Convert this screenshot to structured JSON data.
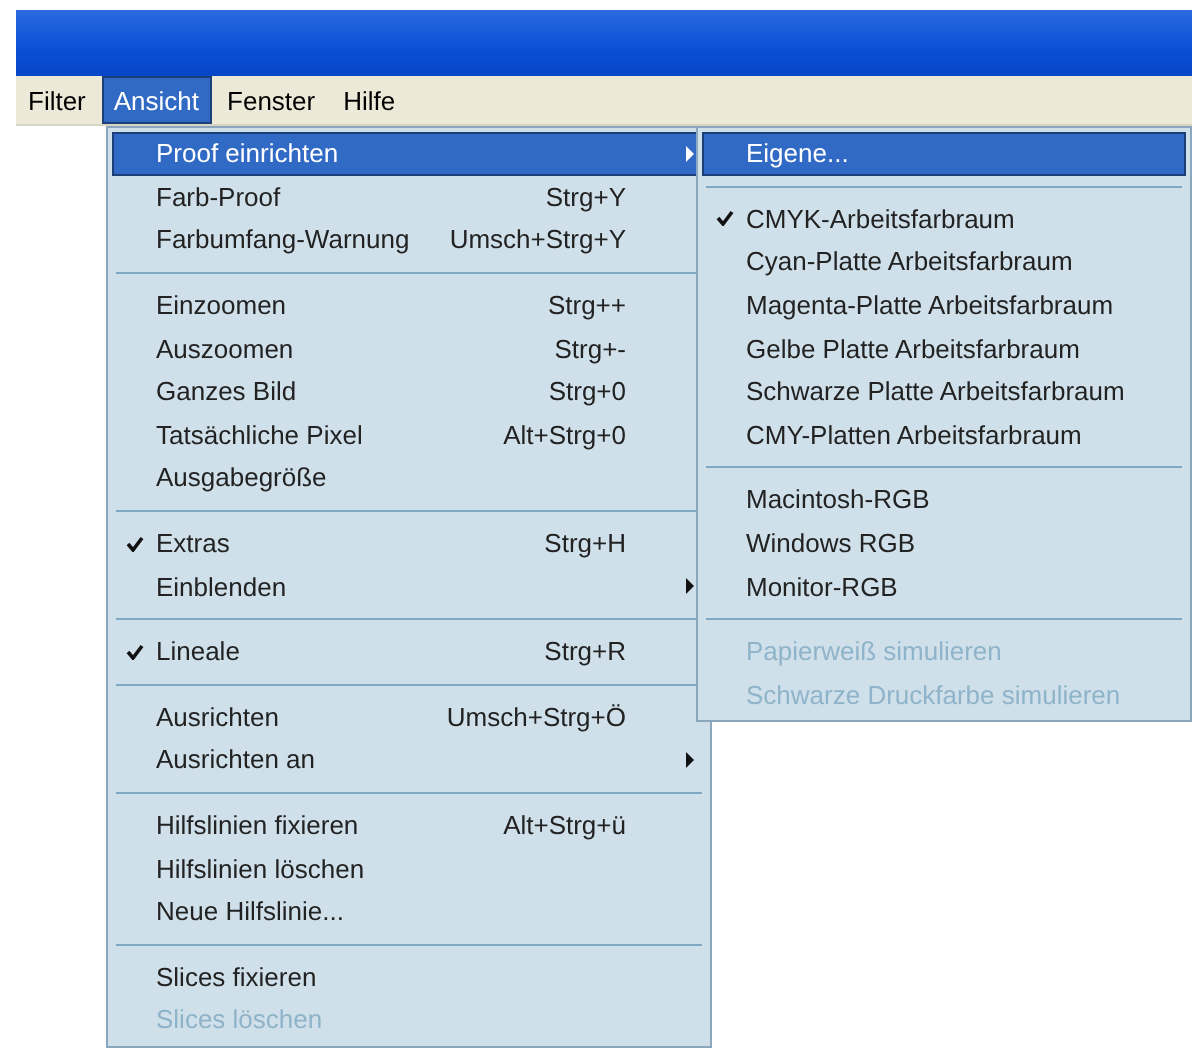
{
  "menubar": [
    {
      "label": "Filter",
      "selected": false
    },
    {
      "label": "Ansicht",
      "selected": true
    },
    {
      "label": "Fenster",
      "selected": false
    },
    {
      "label": "Hilfe",
      "selected": false
    }
  ],
  "menu": [
    {
      "kind": "item",
      "label": "Proof einrichten",
      "submenu": true,
      "selected": true,
      "checked": false,
      "disabled": false
    },
    {
      "kind": "item",
      "label": "Farb-Proof",
      "shortcut": "Strg+Y",
      "selected": false,
      "checked": false,
      "disabled": false
    },
    {
      "kind": "item",
      "label": "Farbumfang-Warnung",
      "shortcut": "Umsch+Strg+Y",
      "selected": false,
      "checked": false,
      "disabled": false
    },
    {
      "kind": "separator"
    },
    {
      "kind": "item",
      "label": "Einzoomen",
      "shortcut": "Strg++",
      "selected": false,
      "checked": false,
      "disabled": false
    },
    {
      "kind": "item",
      "label": "Auszoomen",
      "shortcut": "Strg+-",
      "selected": false,
      "checked": false,
      "disabled": false
    },
    {
      "kind": "item",
      "label": "Ganzes Bild",
      "shortcut": "Strg+0",
      "selected": false,
      "checked": false,
      "disabled": false
    },
    {
      "kind": "item",
      "label": "Tatsächliche Pixel",
      "shortcut": "Alt+Strg+0",
      "selected": false,
      "checked": false,
      "disabled": false
    },
    {
      "kind": "item",
      "label": "Ausgabegröße",
      "selected": false,
      "checked": false,
      "disabled": false
    },
    {
      "kind": "separator"
    },
    {
      "kind": "item",
      "label": "Extras",
      "shortcut": "Strg+H",
      "selected": false,
      "checked": true,
      "disabled": false
    },
    {
      "kind": "item",
      "label": "Einblenden",
      "submenu": true,
      "selected": false,
      "checked": false,
      "disabled": false
    },
    {
      "kind": "separator"
    },
    {
      "kind": "item",
      "label": "Lineale",
      "shortcut": "Strg+R",
      "selected": false,
      "checked": true,
      "disabled": false
    },
    {
      "kind": "separator"
    },
    {
      "kind": "item",
      "label": "Ausrichten",
      "shortcut": "Umsch+Strg+Ö",
      "selected": false,
      "checked": false,
      "disabled": false
    },
    {
      "kind": "item",
      "label": "Ausrichten an",
      "submenu": true,
      "selected": false,
      "checked": false,
      "disabled": false
    },
    {
      "kind": "separator"
    },
    {
      "kind": "item",
      "label": "Hilfslinien fixieren",
      "shortcut": "Alt+Strg+ü",
      "selected": false,
      "checked": false,
      "disabled": false
    },
    {
      "kind": "item",
      "label": "Hilfslinien löschen",
      "selected": false,
      "checked": false,
      "disabled": false
    },
    {
      "kind": "item",
      "label": "Neue Hilfslinie...",
      "selected": false,
      "checked": false,
      "disabled": false
    },
    {
      "kind": "separator"
    },
    {
      "kind": "item",
      "label": "Slices fixieren",
      "selected": false,
      "checked": false,
      "disabled": false
    },
    {
      "kind": "item",
      "label": "Slices löschen",
      "selected": false,
      "checked": false,
      "disabled": true
    }
  ],
  "submenu": [
    {
      "kind": "item",
      "label": "Eigene...",
      "selected": true,
      "checked": false,
      "disabled": false
    },
    {
      "kind": "separator"
    },
    {
      "kind": "item",
      "label": "CMYK-Arbeitsfarbraum",
      "selected": false,
      "checked": true,
      "disabled": false
    },
    {
      "kind": "item",
      "label": "Cyan-Platte Arbeitsfarbraum",
      "selected": false,
      "checked": false,
      "disabled": false
    },
    {
      "kind": "item",
      "label": "Magenta-Platte Arbeitsfarbraum",
      "selected": false,
      "checked": false,
      "disabled": false
    },
    {
      "kind": "item",
      "label": "Gelbe Platte Arbeitsfarbraum",
      "selected": false,
      "checked": false,
      "disabled": false
    },
    {
      "kind": "item",
      "label": "Schwarze Platte Arbeitsfarbraum",
      "selected": false,
      "checked": false,
      "disabled": false
    },
    {
      "kind": "item",
      "label": "CMY-Platten Arbeitsfarbraum",
      "selected": false,
      "checked": false,
      "disabled": false
    },
    {
      "kind": "separator"
    },
    {
      "kind": "item",
      "label": "Macintosh-RGB",
      "selected": false,
      "checked": false,
      "disabled": false
    },
    {
      "kind": "item",
      "label": "Windows RGB",
      "selected": false,
      "checked": false,
      "disabled": false
    },
    {
      "kind": "item",
      "label": "Monitor-RGB",
      "selected": false,
      "checked": false,
      "disabled": false
    },
    {
      "kind": "separator"
    },
    {
      "kind": "item",
      "label": "Papierweiß simulieren",
      "selected": false,
      "checked": false,
      "disabled": true
    },
    {
      "kind": "item",
      "label": "Schwarze Druckfarbe simulieren",
      "selected": false,
      "checked": false,
      "disabled": true
    }
  ]
}
